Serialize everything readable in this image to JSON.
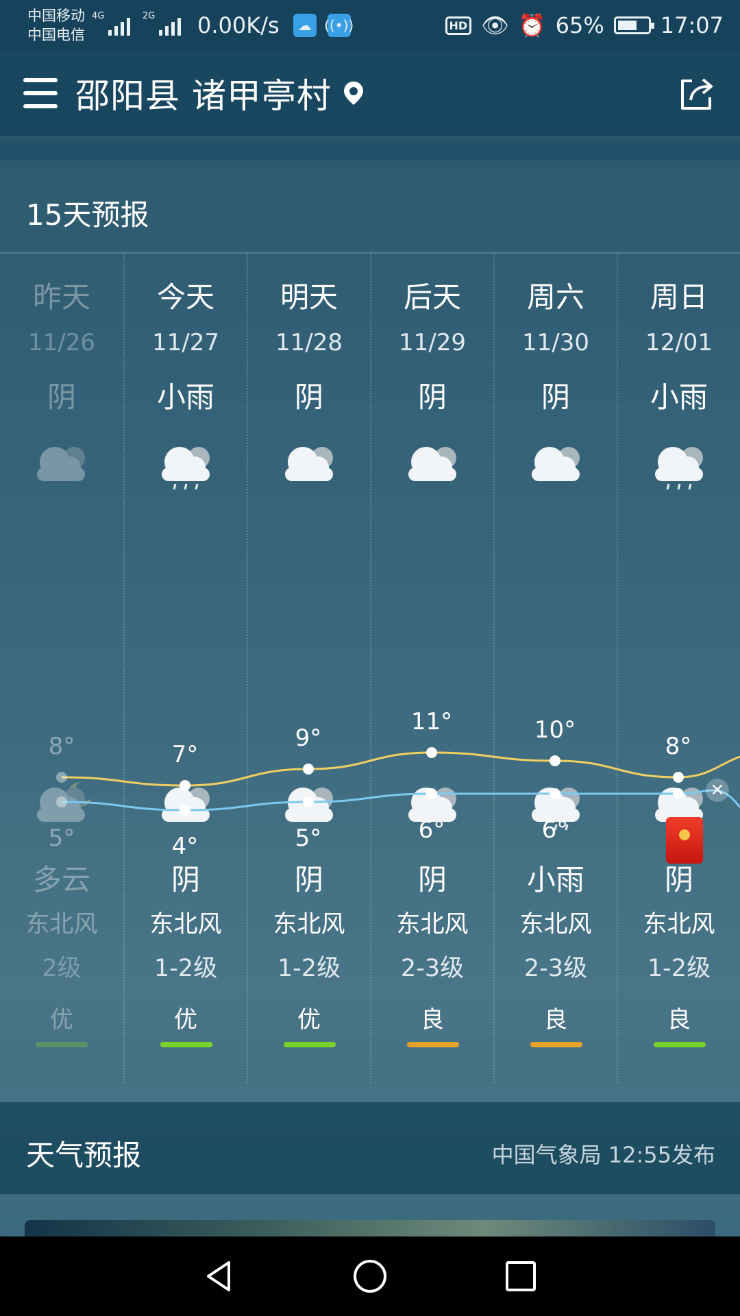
{
  "status_bar": {
    "carrier1": "中国移动",
    "carrier2": "中国电信",
    "sig1_tag": "4G",
    "sig2_tag": "2G",
    "net_speed": "0.00K/s",
    "hd": "HD",
    "battery": "65%",
    "battery_level": 0.65,
    "time": "17:07"
  },
  "header": {
    "location": "邵阳县 诸甲亭村",
    "menu_icon": "menu-icon",
    "share_icon": "share-icon"
  },
  "forecast": {
    "title": "15天预报",
    "days": [
      {
        "day": "昨天",
        "date": "11/26",
        "cond_day": "阴",
        "icon_day": "cloud-icon",
        "high": "8°",
        "low": "5°",
        "icon_night": "cloud-moon-icon",
        "cond_night": "多云",
        "wind_dir": "东北风",
        "wind_lvl": "2级",
        "aqi": "优",
        "aqi_color": "#7bd12b",
        "past": true
      },
      {
        "day": "今天",
        "date": "11/27",
        "cond_day": "小雨",
        "icon_day": "rain-cloud-icon",
        "high": "7°",
        "low": "4°",
        "icon_night": "cloud-icon",
        "cond_night": "阴",
        "wind_dir": "东北风",
        "wind_lvl": "1-2级",
        "aqi": "优",
        "aqi_color": "#7bd12b",
        "past": false
      },
      {
        "day": "明天",
        "date": "11/28",
        "cond_day": "阴",
        "icon_day": "cloud-icon",
        "high": "9°",
        "low": "5°",
        "icon_night": "cloud-icon",
        "cond_night": "阴",
        "wind_dir": "东北风",
        "wind_lvl": "1-2级",
        "aqi": "优",
        "aqi_color": "#7bd12b",
        "past": false
      },
      {
        "day": "后天",
        "date": "11/29",
        "cond_day": "阴",
        "icon_day": "cloud-icon",
        "high": "11°",
        "low": "6°",
        "icon_night": "cloud-icon",
        "cond_night": "阴",
        "wind_dir": "东北风",
        "wind_lvl": "2-3级",
        "aqi": "良",
        "aqi_color": "#e9a12a",
        "past": false
      },
      {
        "day": "周六",
        "date": "11/30",
        "cond_day": "阴",
        "icon_day": "cloud-icon",
        "high": "10°",
        "low": "6°",
        "icon_night": "rain-cloud-icon",
        "cond_night": "小雨",
        "wind_dir": "东北风",
        "wind_lvl": "2-3级",
        "aqi": "良",
        "aqi_color": "#e9a12a",
        "past": false
      },
      {
        "day": "周日",
        "date": "12/01",
        "cond_day": "小雨",
        "icon_day": "rain-cloud-icon",
        "high": "8°",
        "low": "6°",
        "icon_night": "cloud-icon",
        "cond_night": "阴",
        "wind_dir": "东北风",
        "wind_lvl": "1-2级",
        "aqi": "良",
        "aqi_color": "#7bd12b",
        "past": false
      }
    ],
    "high_values": [
      8,
      7,
      9,
      11,
      10,
      8
    ],
    "low_values": [
      5,
      4,
      5,
      6,
      6,
      6
    ],
    "high_color": "#f0d060",
    "low_color": "#7cc8ef"
  },
  "report": {
    "title": "天气预报",
    "source": "中国气象局 12:55发布"
  }
}
